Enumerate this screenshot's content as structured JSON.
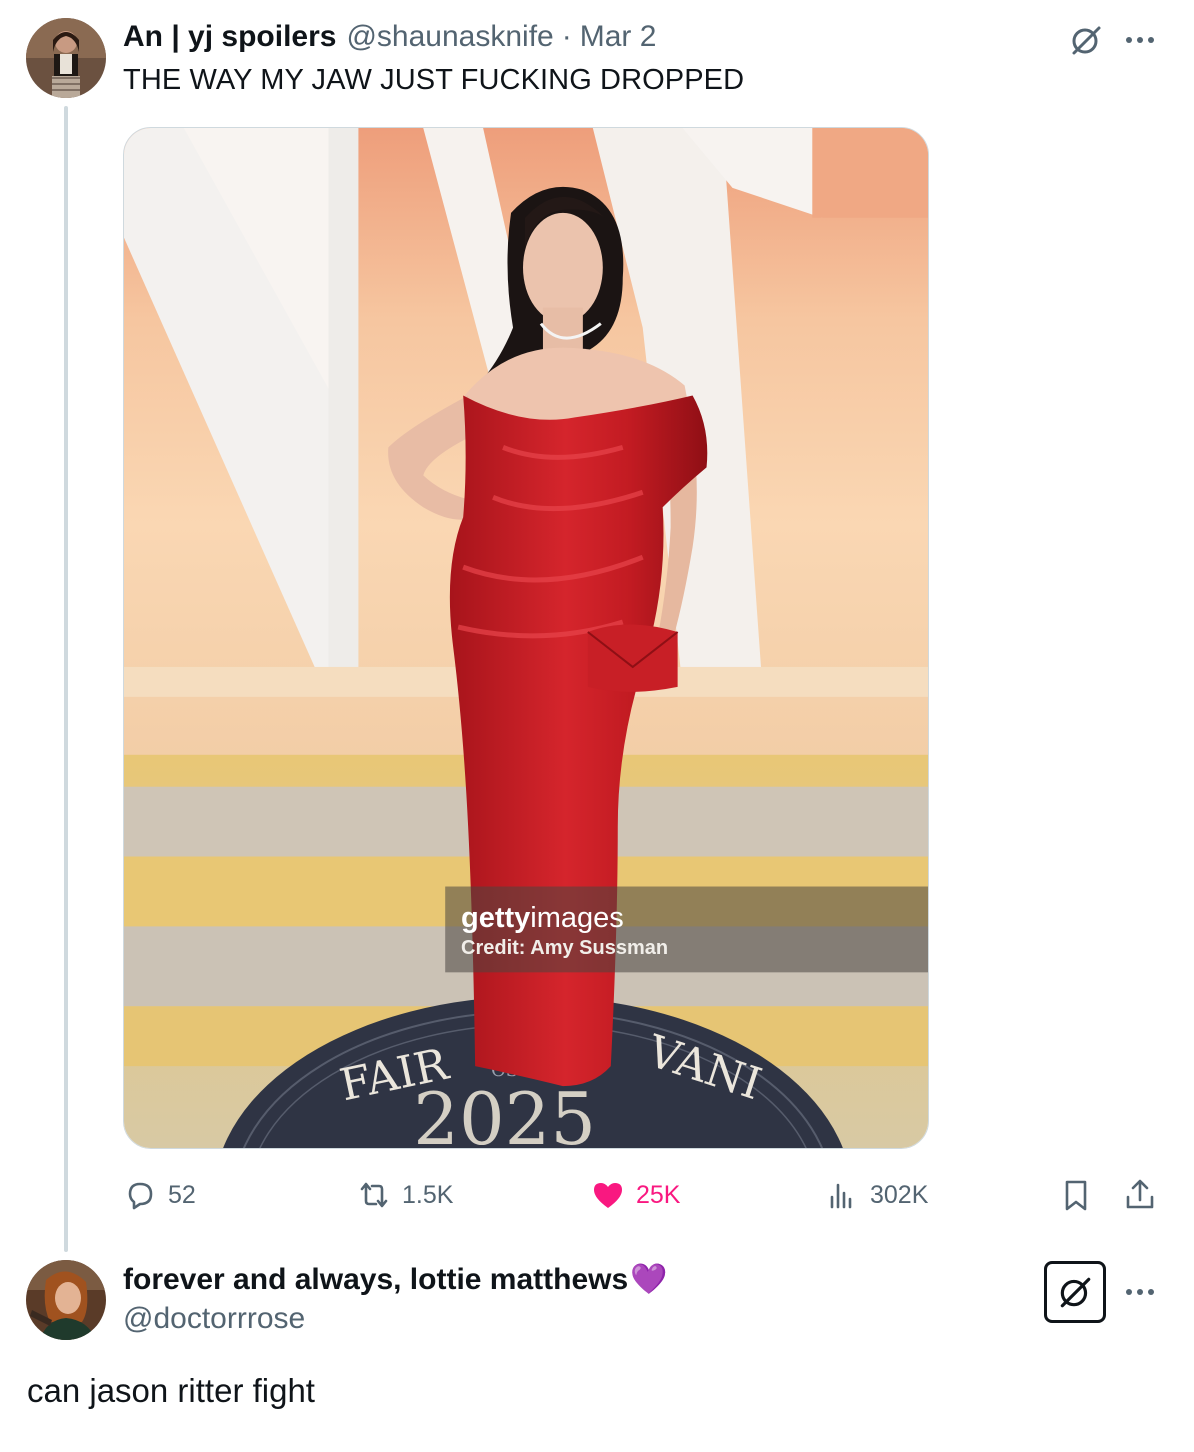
{
  "post": {
    "display_name": "An | yj spoilers",
    "handle": "@shaunasknife",
    "separator": "·",
    "date": "Mar 2",
    "text": "THE WAY MY JAW JUST FUCKING DROPPED",
    "media_watermark": {
      "brand_bold": "getty",
      "brand_light": "images",
      "credit": "Credit: Amy Sussman",
      "floor_text_left": "FAIR",
      "floor_text_right": "VANI",
      "floor_year": "2025",
      "floor_small": "OSC"
    },
    "actions": {
      "replies": "52",
      "reposts": "1.5K",
      "likes": "25K",
      "views": "302K"
    },
    "liked_color": "#f91880"
  },
  "reply": {
    "display_name": "forever and always, lottie matthews",
    "name_emoji": "💜",
    "handle": "@doctorrrose",
    "text": "can jason ritter fight"
  },
  "icons": {
    "grok": "slashed-circle-icon",
    "more": "more-dots-icon",
    "reply": "speech-bubble-icon",
    "repost": "repost-arrows-icon",
    "like": "heart-icon",
    "views": "bar-chart-icon",
    "bookmark": "bookmark-icon",
    "share": "share-upload-icon"
  }
}
